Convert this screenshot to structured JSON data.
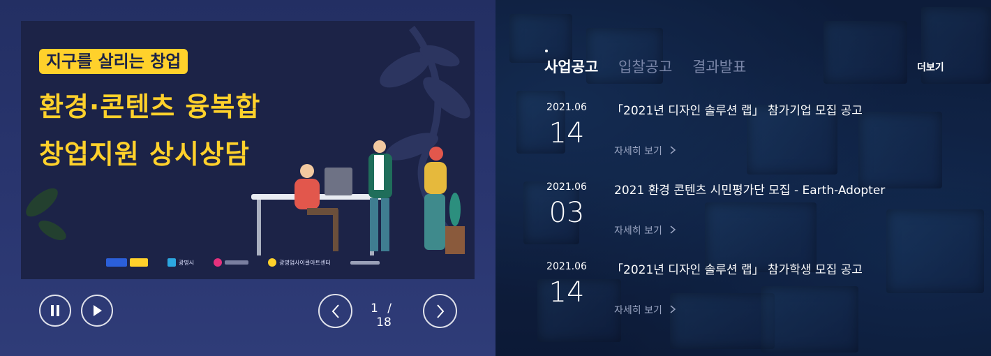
{
  "banner": {
    "tag": "지구를 살리는 창업",
    "headline_line1": "환경·콘텐츠 융복합",
    "headline_line2": "창업지원 상시상담",
    "logos": [
      "광명시",
      "광명업사이클아트센터"
    ]
  },
  "slider": {
    "current": "1",
    "separator": "/",
    "total": "18"
  },
  "notices": {
    "tabs": [
      {
        "label": "사업공고",
        "active": true
      },
      {
        "label": "입찰공고",
        "active": false
      },
      {
        "label": "결과발표",
        "active": false
      }
    ],
    "more_label": "더보기",
    "items": [
      {
        "year_month": "2021.06",
        "day": "14",
        "title": "「2021년 디자인 솔루션 랩」 참가기업 모집 공고",
        "detail": "자세히 보기"
      },
      {
        "year_month": "2021.06",
        "day": "03",
        "title": "2021 환경 콘텐츠 시민평가단 모집 - Earth-Adopter",
        "detail": "자세히 보기"
      },
      {
        "year_month": "2021.06",
        "day": "14",
        "title": "「2021년 디자인 솔루션 랩」 참가학생 모집 공고",
        "detail": "자세히 보기"
      }
    ]
  },
  "icons": {
    "pause": "pause-icon",
    "play": "play-icon",
    "prev": "chevron-left-icon",
    "next": "chevron-right-icon",
    "detail_arrow": "chevron-right-icon"
  },
  "colors": {
    "accent_yellow": "#ffd12b",
    "banner_bg": "#1c2347",
    "page_bg": "#232f63"
  }
}
